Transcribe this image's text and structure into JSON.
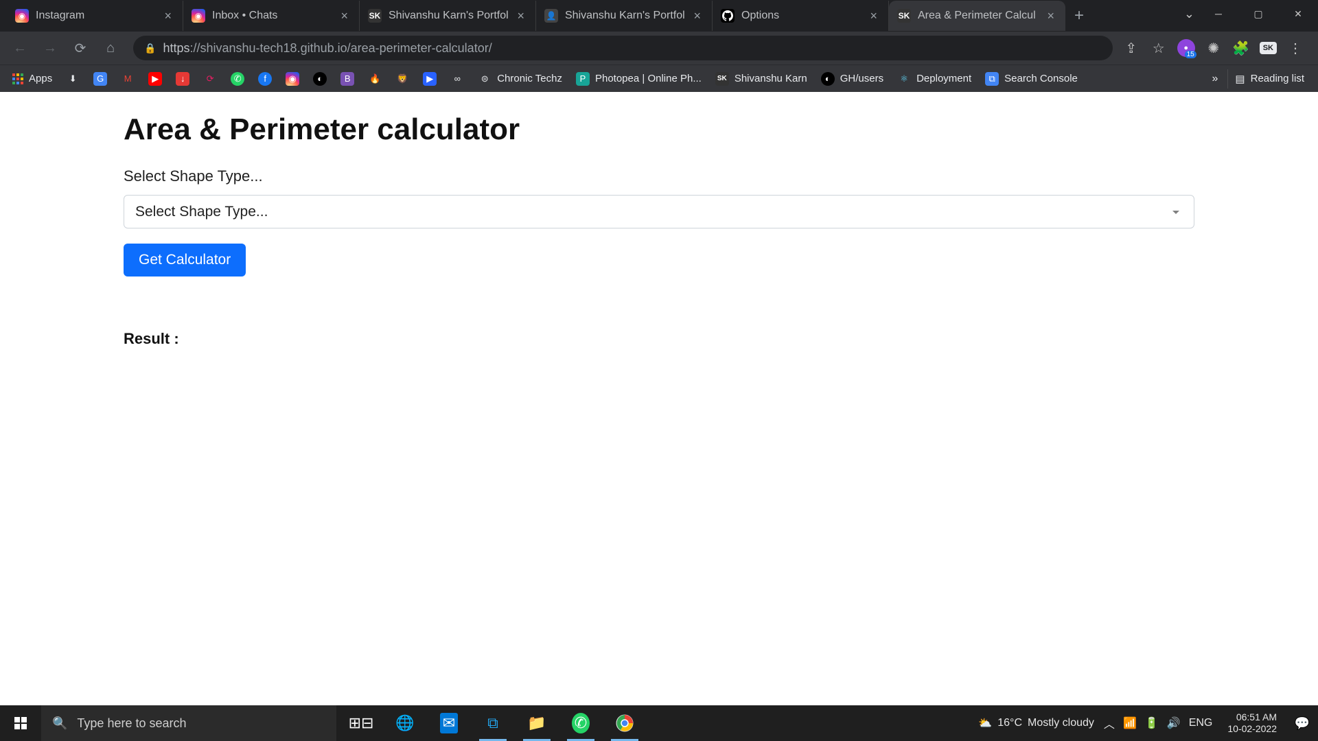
{
  "browser": {
    "tabs": [
      {
        "title": "Instagram",
        "favicon": "ig"
      },
      {
        "title": "Inbox • Chats",
        "favicon": "ig"
      },
      {
        "title": "Shivanshu Karn's Portfol",
        "favicon": "sk"
      },
      {
        "title": "Shivanshu Karn's Portfol",
        "favicon": "pf"
      },
      {
        "title": "Options",
        "favicon": "gh"
      },
      {
        "title": "Area & Perimeter Calcul",
        "favicon": "sk",
        "active": true
      }
    ],
    "url_secure": "https",
    "url_rest": "://shivanshu-tech18.github.io/area-perimeter-calculator/",
    "ext_count": "15",
    "profile_badge": "SK"
  },
  "bookmarks": {
    "apps_label": "Apps",
    "items": [
      {
        "label": "Chronic Techz"
      },
      {
        "label": "Photopea | Online Ph..."
      },
      {
        "label": "Shivanshu Karn"
      },
      {
        "label": "GH/users"
      },
      {
        "label": "Deployment"
      },
      {
        "label": "Search Console"
      }
    ],
    "reading_list": "Reading list",
    "overflow": "»"
  },
  "page": {
    "title": "Area & Perimeter calculator",
    "label": "Select Shape Type...",
    "select_placeholder": "Select Shape Type...",
    "button": "Get Calculator",
    "result_label": "Result :"
  },
  "taskbar": {
    "search_placeholder": "Type here to search",
    "weather_temp": "16°C",
    "weather_desc": "Mostly cloudy",
    "lang": "ENG",
    "time": "06:51 AM",
    "date": "10-02-2022"
  }
}
